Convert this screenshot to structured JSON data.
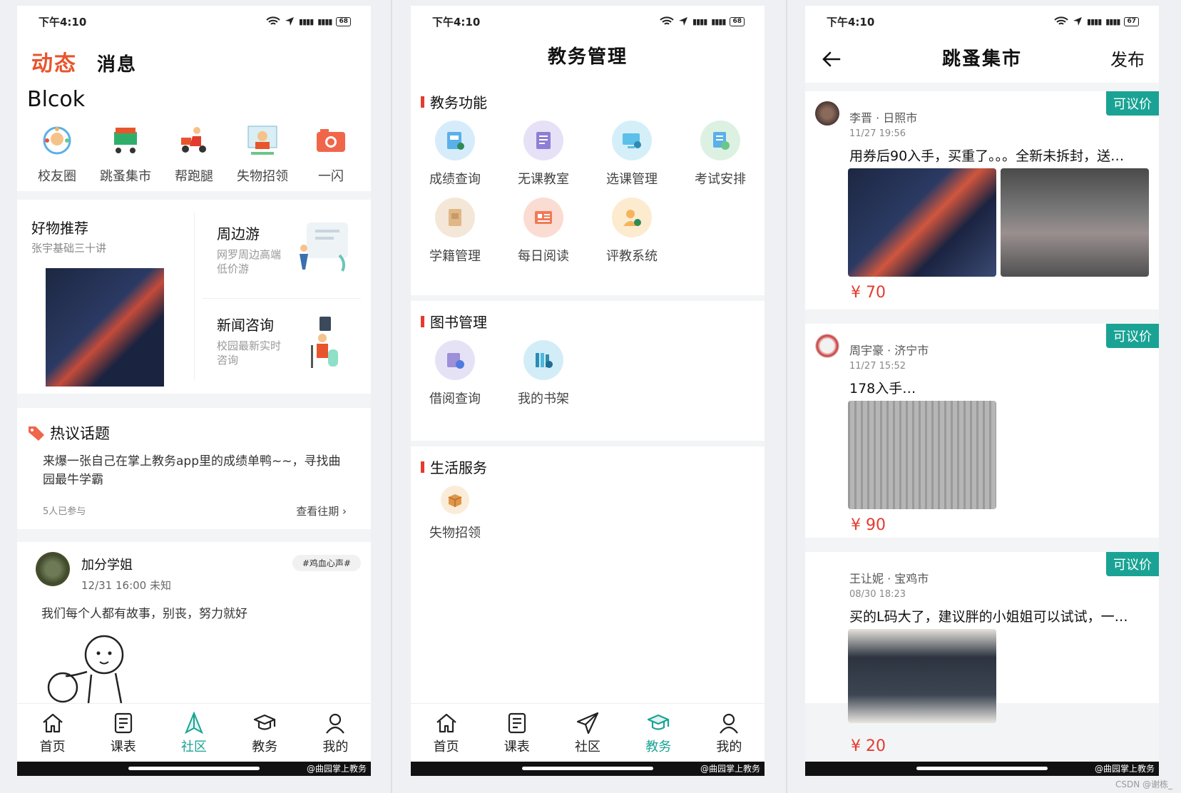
{
  "status": {
    "time": "下午4:10",
    "battery_1": "68",
    "battery_2": "68",
    "battery_3": "67"
  },
  "p1": {
    "tab_active": "动态",
    "tab_other": "消息",
    "brand": "Blcok",
    "quick": [
      {
        "label": "校友圈",
        "icon": "friends-circle-icon"
      },
      {
        "label": "跳蚤集市",
        "icon": "shopping-cart-icon"
      },
      {
        "label": "帮跑腿",
        "icon": "delivery-icon"
      },
      {
        "label": "失物招领",
        "icon": "lost-found-icon"
      },
      {
        "label": "一闪",
        "icon": "camera-icon"
      }
    ],
    "rec": {
      "title": "好物推荐",
      "sub": "张宇基础三十讲",
      "r1_title": "周边游",
      "r1_sub": "网罗周边高端低价游",
      "r2_title": "新闻咨询",
      "r2_sub": "校园最新实时咨询"
    },
    "hot": {
      "title": "热议话题",
      "text": "来爆一张自己在掌上教务app里的成绩单鸭~~，寻找曲园最牛学霸",
      "count": "5人已参与",
      "more": "查看往期"
    },
    "post": {
      "name": "加分学姐",
      "meta": "12/31 16:00  未知",
      "tag": "#鸡血心声#",
      "text": "我们每个人都有故事，别丧，努力就好"
    },
    "tabs": [
      {
        "label": "首页",
        "icon": "home-icon"
      },
      {
        "label": "课表",
        "icon": "schedule-icon"
      },
      {
        "label": "社区",
        "icon": "community-icon"
      },
      {
        "label": "教务",
        "icon": "academic-icon"
      },
      {
        "label": "我的",
        "icon": "profile-icon"
      }
    ],
    "active_tab": 2
  },
  "p2": {
    "title": "教务管理",
    "sec1": {
      "title": "教务功能",
      "items": [
        {
          "label": "成绩查询",
          "icon": "grade-query-icon",
          "color": "#5ab0e8"
        },
        {
          "label": "无课教室",
          "icon": "free-classroom-icon",
          "color": "#8e7fd6"
        },
        {
          "label": "选课管理",
          "icon": "course-select-icon",
          "color": "#5cc0e8"
        },
        {
          "label": "考试安排",
          "icon": "exam-schedule-icon",
          "color": "#6cc58c"
        },
        {
          "label": "学籍管理",
          "icon": "student-record-icon",
          "color": "#e0b787"
        },
        {
          "label": "每日阅读",
          "icon": "daily-reading-icon",
          "color": "#f07a55"
        },
        {
          "label": "评教系统",
          "icon": "teacher-eval-icon",
          "color": "#f5b45c"
        }
      ]
    },
    "sec2": {
      "title": "图书管理",
      "items": [
        {
          "label": "借阅查询",
          "icon": "borrow-query-icon",
          "color": "#9d8fd8"
        },
        {
          "label": "我的书架",
          "icon": "bookshelf-icon",
          "color": "#4fb6de"
        }
      ]
    },
    "sec3": {
      "title": "生活服务",
      "items": [
        {
          "label": "失物招领",
          "icon": "lost-box-icon",
          "color": "#f2b36a"
        }
      ]
    },
    "active_tab": 3
  },
  "p3": {
    "title": "跳蚤集市",
    "publish": "发布",
    "items": [
      {
        "badge": "可议价",
        "seller": "李晋 · 日照市",
        "time": "11/27 19:56",
        "desc": "用券后90入手，买重了。。。全新未拆封，送…",
        "price": "¥ 70"
      },
      {
        "badge": "可议价",
        "seller": "周宇豪 · 济宁市",
        "time": "11/27 15:52",
        "desc": "178入手…",
        "price": "¥ 90"
      },
      {
        "badge": "可议价",
        "seller": "王让妮 · 宝鸡市",
        "time": "08/30 18:23",
        "desc": "买的L码大了，建议胖的小姐姐可以试试，一…",
        "price": "¥ 20"
      }
    ]
  },
  "watermark": "@曲园掌上教务",
  "csdn": "CSDN @谢栋_",
  "colors": {
    "accent": "#1aa394",
    "brand_orange": "#e8552d",
    "section_red": "#e43b2f",
    "price_red": "#e43b2f"
  }
}
